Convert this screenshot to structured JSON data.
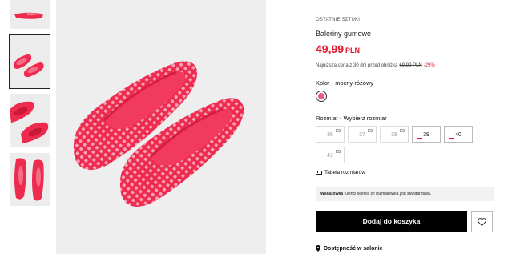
{
  "product": {
    "badge": "OSTATNIE SZTUKI",
    "name": "Baleriny gumowe",
    "price": "49,99",
    "currency": "PLN",
    "lowest_price_text": "Najniższa cena z 30 dni przed obniżką",
    "old_price": "69,99 PLN",
    "discount": "-29%"
  },
  "color": {
    "label": "Kolor",
    "value": "mocny różowy",
    "swatch_color": "#f0587c"
  },
  "sizes": {
    "label": "Rozmiar",
    "prompt": "Wybierz rozmiar",
    "items": [
      {
        "size": "36",
        "available": false
      },
      {
        "size": "37",
        "available": false
      },
      {
        "size": "38",
        "available": false
      },
      {
        "size": "39",
        "available": true
      },
      {
        "size": "40",
        "available": true
      },
      {
        "size": "41",
        "available": false
      }
    ]
  },
  "size_chart_link": "Tabela rozmiarów",
  "hint": {
    "label": "Wskazówka",
    "text": "Klienci ocenili, że rozmiarówka jest standardowa."
  },
  "add_to_cart": "Dodaj do koszyka",
  "store_availability": "Dostępność w salonie",
  "colors": {
    "accent": "#e0172c",
    "shoe": "#ee2a4f"
  }
}
